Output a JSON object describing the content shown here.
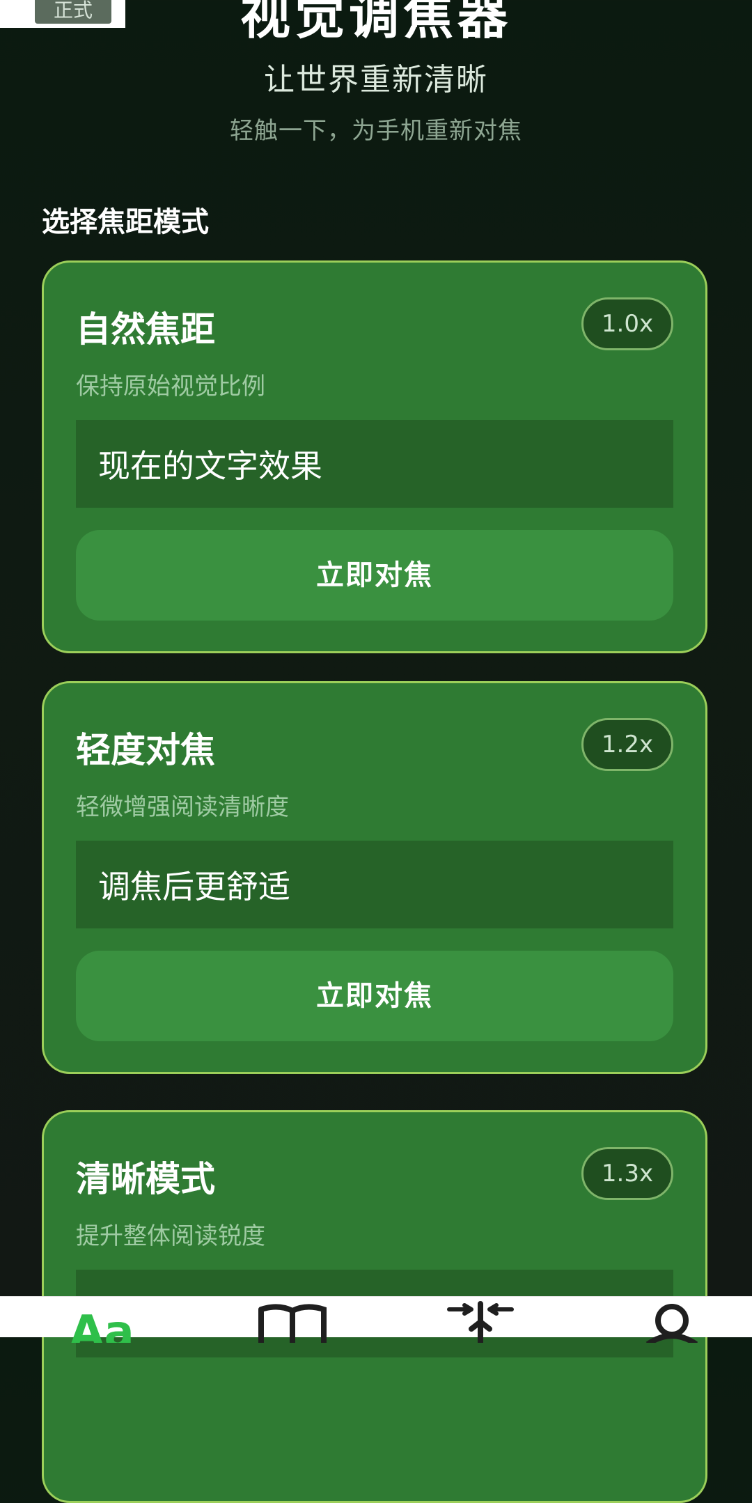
{
  "env_badge": {
    "label": "正式"
  },
  "hero": {
    "title": "视觉调焦器",
    "subtitle": "让世界重新清晰",
    "hint": "轻触一下，为手机重新对焦"
  },
  "section": {
    "title": "选择焦距模式"
  },
  "cards": [
    {
      "title": "自然焦距",
      "zoom": "1.0x",
      "description": "保持原始视觉比例",
      "preview_text": "现在的文字效果",
      "action_label": "立即对焦"
    },
    {
      "title": "轻度对焦",
      "zoom": "1.2x",
      "description": "轻微增强阅读清晰度",
      "preview_text": "调焦后更舒适",
      "action_label": "立即对焦"
    },
    {
      "title": "清晰模式",
      "zoom": "1.3x",
      "description": "提升整体阅读锐度"
    }
  ],
  "bottom_nav": {
    "items": [
      {
        "icon": "font-size-icon",
        "label": "Aa",
        "active": true
      },
      {
        "icon": "book-icon"
      },
      {
        "icon": "compress-arrows-icon"
      },
      {
        "icon": "user-icon"
      }
    ]
  },
  "colors": {
    "card_bg": "#2f7b33",
    "card_border": "#9ccf5a",
    "button_bg": "#3a9140",
    "accent_green": "#2fbf4a"
  }
}
